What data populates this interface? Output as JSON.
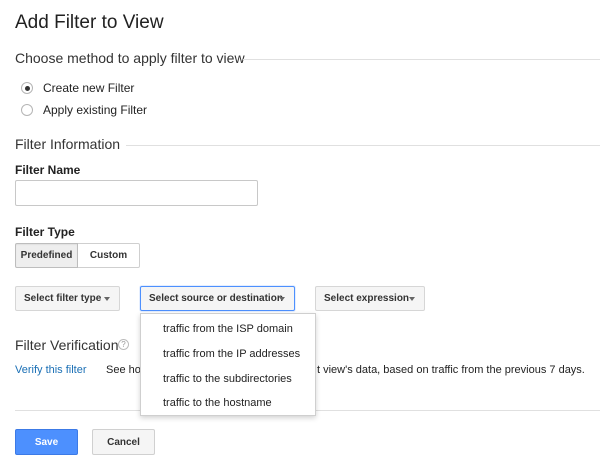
{
  "page": {
    "title": "Add Filter to View"
  },
  "method": {
    "heading": "Choose method to apply filter to view",
    "options": [
      {
        "label": "Create new Filter",
        "selected": true
      },
      {
        "label": "Apply existing Filter",
        "selected": false
      }
    ]
  },
  "filter_info": {
    "heading": "Filter Information",
    "name_label": "Filter Name",
    "name_value": "",
    "type_label": "Filter Type",
    "type_tabs": [
      {
        "label": "Predefined",
        "active": true
      },
      {
        "label": "Custom",
        "active": false
      }
    ],
    "selects": {
      "filter_type": "Select filter type",
      "source_destination": "Select source or destination",
      "expression": "Select expression"
    },
    "dropdown_options": [
      "traffic from the ISP domain",
      "traffic from the IP addresses",
      "traffic to the subdirectories",
      "traffic to the hostname"
    ]
  },
  "verification": {
    "heading": "Filter Verification",
    "help_symbol": "?",
    "link": "Verify this filter",
    "text_start": "See ho",
    "text_end": "t view's data, based on traffic from the previous 7 days."
  },
  "actions": {
    "save": "Save",
    "cancel": "Cancel"
  },
  "colors": {
    "accent": "#4d90fe",
    "link": "#1a6fb5"
  }
}
